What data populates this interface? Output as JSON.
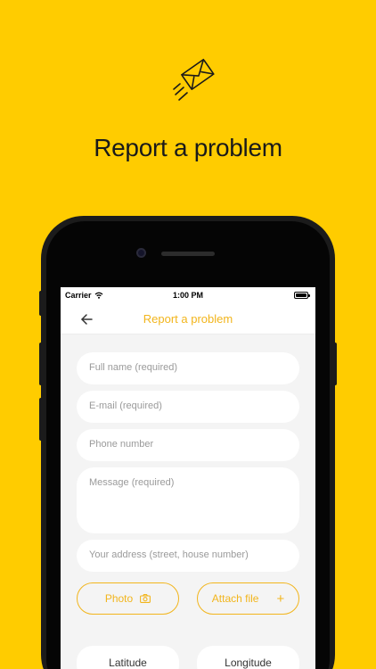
{
  "headline": "Report a problem",
  "statusbar": {
    "carrier": "Carrier",
    "time": "1:00 PM"
  },
  "navbar": {
    "title": "Report a problem"
  },
  "form": {
    "full_name_placeholder": "Full name (required)",
    "email_placeholder": "E-mail (required)",
    "phone_placeholder": "Phone number",
    "message_placeholder": "Message (required)",
    "address_placeholder": "Your address (street, house number)",
    "photo_label": "Photo",
    "attach_label": "Attach file",
    "attach_plus": "+",
    "latitude_label": "Latitude",
    "longitude_label": "Longitude"
  },
  "colors": {
    "background": "#FFCC00",
    "accent": "#F2B51C",
    "screen_bg": "#F4F4F4"
  },
  "icons": [
    "envelope-send-icon",
    "wifi-icon",
    "battery-icon",
    "back-arrow-icon",
    "camera-icon"
  ]
}
